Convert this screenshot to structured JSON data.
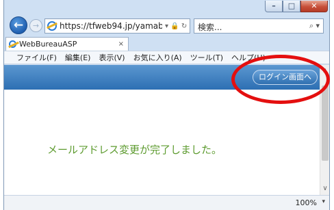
{
  "window_controls": {
    "minimize": "–",
    "maximize": "□",
    "close": "✕"
  },
  "nav": {
    "back_glyph": "←",
    "forward_glyph": "→"
  },
  "address": {
    "url": "https://tfweb94.jp/yamab",
    "tools": "▾ 🔒 ↻"
  },
  "search": {
    "value": "検索...",
    "icon_glyph": "⌕ ▾"
  },
  "tab": {
    "title": "WebBureauASP",
    "close": "×"
  },
  "menu": [
    "ファイル(F)",
    "編集(E)",
    "表示(V)",
    "お気に入り(A)",
    "ツール(T)",
    "ヘルプ(H)"
  ],
  "page": {
    "login_button": "ログイン画面へ",
    "message": "メールアドレス変更が完了しました。"
  },
  "scroll": {
    "up": "∧",
    "down": "∨"
  },
  "status": {
    "zoom": "100%",
    "zoom_caret": "▾"
  },
  "colors": {
    "header_blue": "#2d6fb3",
    "message_green": "#5d9b2f",
    "annotation_red": "#e40f0f"
  }
}
